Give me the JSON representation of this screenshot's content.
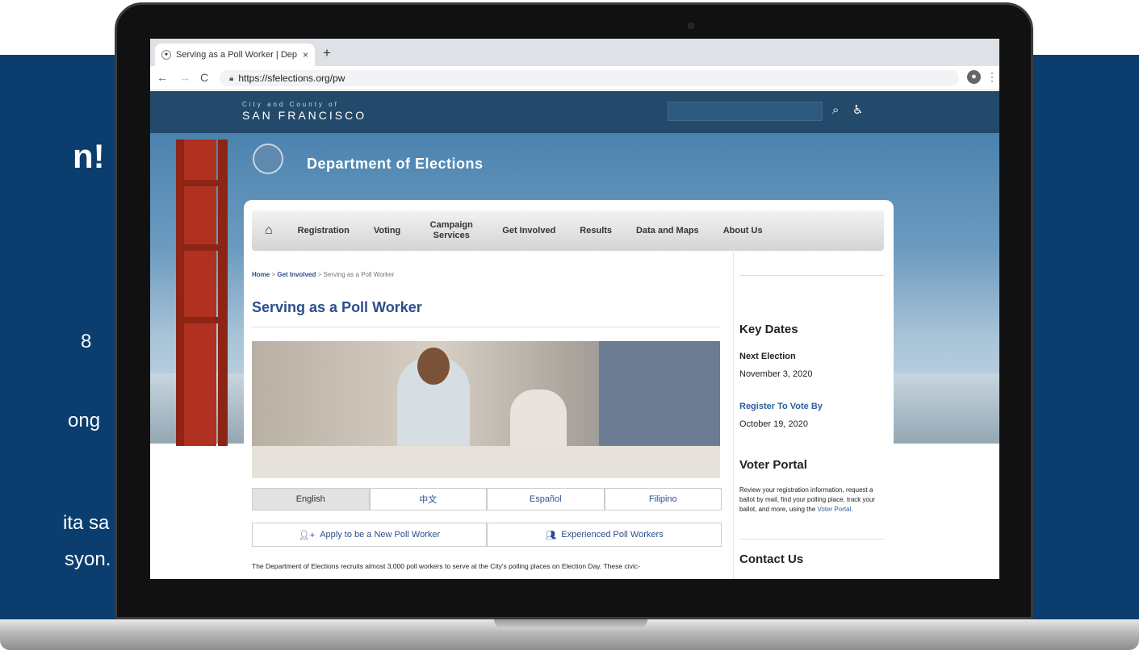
{
  "promo": {
    "headline": "n!",
    "lines": [
      "8",
      "ong",
      "ita sa",
      "syon."
    ]
  },
  "browser": {
    "tab_title": "Serving as a Poll Worker | Dep",
    "tab_close": "×",
    "new_tab": "+",
    "back": "←",
    "forward": "→",
    "reload": "C",
    "url": "https://sfelections.org/pw",
    "menu": "⋮"
  },
  "site": {
    "city_small": "City and County of",
    "city_big": "SAN FRANCISCO",
    "dept_title": "Department of Elections",
    "nav": [
      "Registration",
      "Voting",
      "Campaign Services",
      "Get Involved",
      "Results",
      "Data and Maps",
      "About Us"
    ],
    "breadcrumb": {
      "home": "Home",
      "sep": ">",
      "section": "Get Involved",
      "current": "Serving as a Poll Worker"
    },
    "page_title": "Serving as a Poll Worker",
    "languages": [
      {
        "label": "English",
        "active": true
      },
      {
        "label": "中文",
        "active": false
      },
      {
        "label": "Español",
        "active": false
      },
      {
        "label": "Filipino",
        "active": false
      }
    ],
    "actions": [
      {
        "label": "Apply to be a New Poll Worker",
        "icon": "add-user-icon"
      },
      {
        "label": "Experienced Poll Workers",
        "icon": "group-icon"
      }
    ],
    "intro": "The Department of Elections recruits almost 3,000 poll workers to serve at the City's polling places on Election Day. These civic-",
    "sidebar": {
      "key_dates_title": "Key Dates",
      "next_election_label": "Next Election",
      "next_election_date": "November 3, 2020",
      "register_label": "Register To Vote By",
      "register_date": "October 19, 2020",
      "voter_portal_title": "Voter Portal",
      "voter_portal_text": "Review your registration information, request a ballot by mail, find your polling place, track your ballot, and more, using the ",
      "voter_portal_link": "Voter Portal",
      "voter_portal_end": ".",
      "contact_title": "Contact Us"
    }
  }
}
